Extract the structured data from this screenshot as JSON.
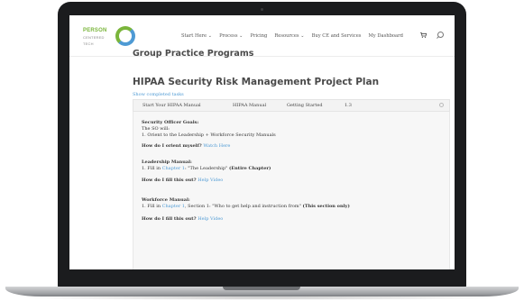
{
  "logo": {
    "line1": "PERSON",
    "line2": "CENTERED",
    "line3": "TECH"
  },
  "nav": {
    "items": [
      "Start Here ⌄",
      "Process ⌄",
      "Pricing",
      "Resources ⌄",
      "Buy CE and Services",
      "My Dashboard"
    ]
  },
  "page": {
    "title": "Group Practice Programs",
    "project_title": "HIPAA Security Risk Management Project Plan",
    "show_completed": "Show completed tasks"
  },
  "task_row": {
    "cells": [
      "Start Your HIPAA Manual",
      "HIPAA Manual",
      "Getting Started",
      "1.3"
    ]
  },
  "panel": {
    "goals_heading": "Security Officer Goals:",
    "goals_line1": "The SO will:",
    "goals_line2": "1. Orient to the Leadership + Workforce Security Manuals",
    "orient_q": "How do I orient myself?",
    "orient_link": "Watch Here",
    "leadership_heading": "Leadership Manual:",
    "leadership_pre": "1. Fill in ",
    "leadership_link": "Chapter 1",
    "leadership_post": ": \"The Leadership\"",
    "leadership_bold": "(Entire Chapter)",
    "fill_q1": "How do I fill this out?",
    "fill_link1": "Help Video",
    "workforce_heading": "Workforce Manual:",
    "workforce_pre": "1. Fill in ",
    "workforce_link": "Chapter 1",
    "workforce_post": ", Section 1: \"Who to get help and instruction from\"",
    "workforce_bold": "(This section only)",
    "fill_q2": "How do I fill this out?",
    "fill_link2": "Help Video"
  },
  "colors": {
    "brand_green": "#7ab53b",
    "link_blue": "#4e9ad4"
  },
  "icons": [
    "cart-icon",
    "search-icon",
    "toggle-icon"
  ]
}
